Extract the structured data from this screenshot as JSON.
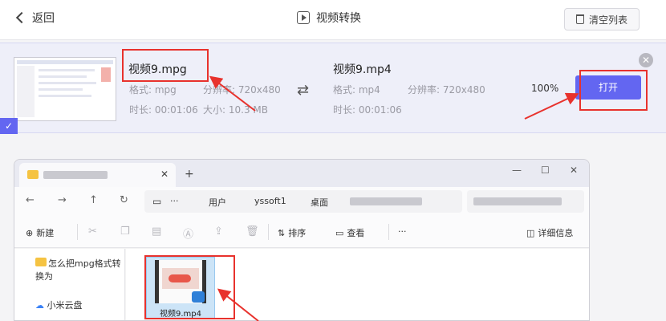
{
  "header": {
    "back_label": "返回",
    "title": "视频转换",
    "clear_label": "清空列表"
  },
  "task": {
    "source": {
      "name": "视频9.mpg",
      "format": "格式: mpg",
      "resolution": "分辨率: 720x480",
      "duration": "时长: 00:01:06",
      "size": "大小:   10.3 MB"
    },
    "target": {
      "name": "视频9.mp4",
      "format": "格式: mp4",
      "resolution": "分辨率: 720x480",
      "duration": "时长: 00:01:06"
    },
    "progress": "100%",
    "open_label": "打开",
    "close_glyph": "✕",
    "convert_glyph": "⇄",
    "check_glyph": "✓"
  },
  "explorer": {
    "tab_close": "✕",
    "tab_add": "+",
    "window_controls": [
      "—",
      "☐",
      "✕"
    ],
    "nav": [
      "←",
      "→",
      "↑",
      "↻"
    ],
    "breadcrumb": [
      "用户",
      "yssoft1",
      "桌面"
    ],
    "breadcrumb_more": "···",
    "toolbar": {
      "new_label": "新建",
      "sort_label": "排序",
      "view_label": "查看",
      "more_glyph": "···",
      "details_label": "详细信息"
    },
    "nav_pane": [
      {
        "label": "怎么把mpg格式转换为"
      },
      {
        "label": "小米云盘"
      }
    ],
    "file": {
      "name": "视频9.mp4"
    }
  },
  "colors": {
    "accent": "#6366f1",
    "annotation": "#e8322d"
  }
}
